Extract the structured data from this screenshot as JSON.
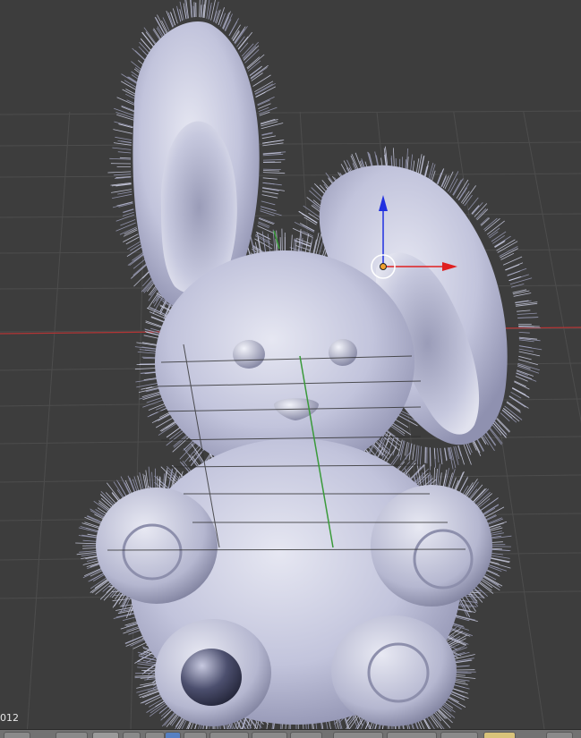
{
  "viewport": {
    "frame_label": "012",
    "colors": {
      "background": "#3d3d3d",
      "grid": "#4b4b4b",
      "grid_major": "#555555",
      "axis_x": "#b33535",
      "axis_y": "#3a9a3a",
      "fur": "#c9cbe0",
      "manip_x": "#e02020",
      "manip_z": "#2030e0"
    },
    "object": "bunny-mesh-with-hair-particles",
    "manipulator": "translate-gizmo"
  },
  "header": {
    "buttons": [
      "view-menu",
      "select-menu",
      "object-menu",
      "mode-select",
      "shading-select",
      "pivot-select",
      "manipulator-toggle",
      "layers",
      "snap-toggle",
      "render-preview"
    ]
  }
}
